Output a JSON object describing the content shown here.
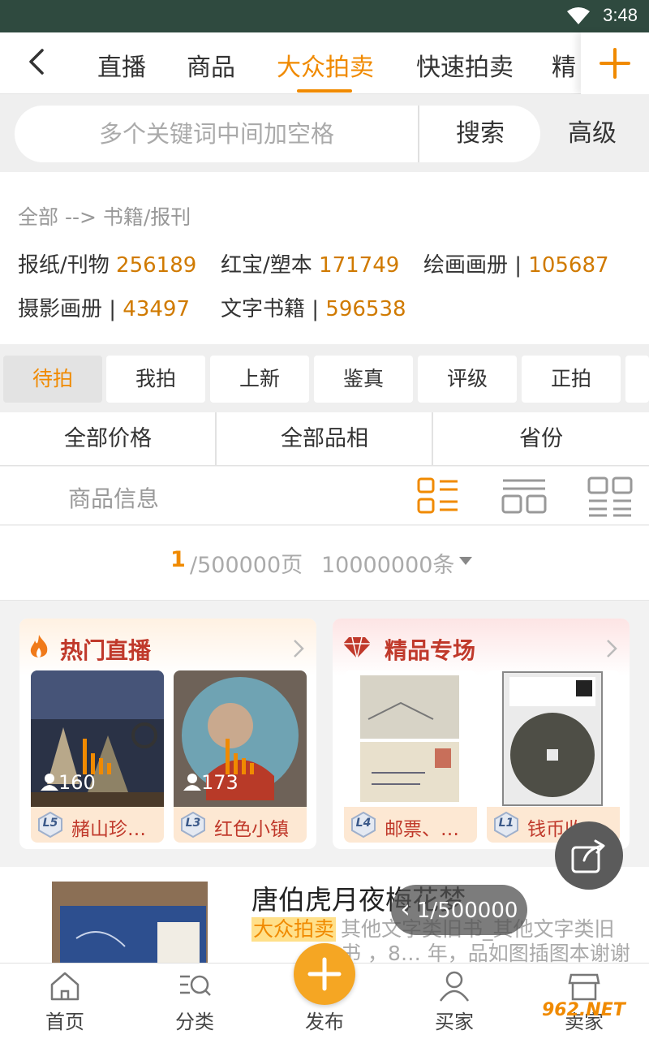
{
  "status": {
    "time": "3:48"
  },
  "tabs": [
    {
      "label": "直播"
    },
    {
      "label": "商品"
    },
    {
      "label": "大众拍卖"
    },
    {
      "label": "快速拍卖"
    },
    {
      "label": "精"
    }
  ],
  "search": {
    "placeholder": "多个关键词中间加空格",
    "button": "搜索",
    "advanced": "高级"
  },
  "category": {
    "breadcrumb": "全部 --> 书籍/报刊",
    "items": [
      {
        "name": "报纸/刊物",
        "count": "256189"
      },
      {
        "name": "红宝/塑本",
        "count": "171749"
      },
      {
        "name": "绘画画册 |",
        "count": "105687"
      },
      {
        "name": "摄影画册 |",
        "count": "43497"
      },
      {
        "name": "文字书籍 |",
        "count": "596538"
      }
    ]
  },
  "chips": [
    {
      "label": "待拍"
    },
    {
      "label": "我拍"
    },
    {
      "label": "上新"
    },
    {
      "label": "鉴真"
    },
    {
      "label": "评级"
    },
    {
      "label": "正拍"
    }
  ],
  "filters": [
    {
      "label": "全部价格"
    },
    {
      "label": "全部品相"
    },
    {
      "label": "省份"
    }
  ],
  "view": {
    "info_label": "商品信息"
  },
  "pager": {
    "current": "1",
    "total": "/500000页",
    "count": "10000000条"
  },
  "promos": [
    {
      "title": "热门直播",
      "items": [
        {
          "viewers": "160",
          "level": "L5",
          "name": "赭山珍…"
        },
        {
          "viewers": "173",
          "level": "L3",
          "name": "红色小镇"
        }
      ]
    },
    {
      "title": "精品专场",
      "items": [
        {
          "level": "L4",
          "name": "邮票、…"
        },
        {
          "level": "L1",
          "name": "钱币收…"
        }
      ]
    }
  ],
  "product": {
    "title": "唐伯虎月夜梅花梦",
    "tag": "大众拍卖",
    "desc": "其他文字类旧书_其他文字类旧书 ，8… 年，品如图插图本谢谢",
    "page_indicator": "1/500000"
  },
  "nav": [
    {
      "label": "首页"
    },
    {
      "label": "分类"
    },
    {
      "label": "发布"
    },
    {
      "label": "买家"
    },
    {
      "label": "卖家"
    }
  ],
  "watermark": "962.NET",
  "colors": {
    "accent": "#f08a00",
    "status_bar": "#2f4a3f",
    "promo_red": "#c0392b"
  }
}
